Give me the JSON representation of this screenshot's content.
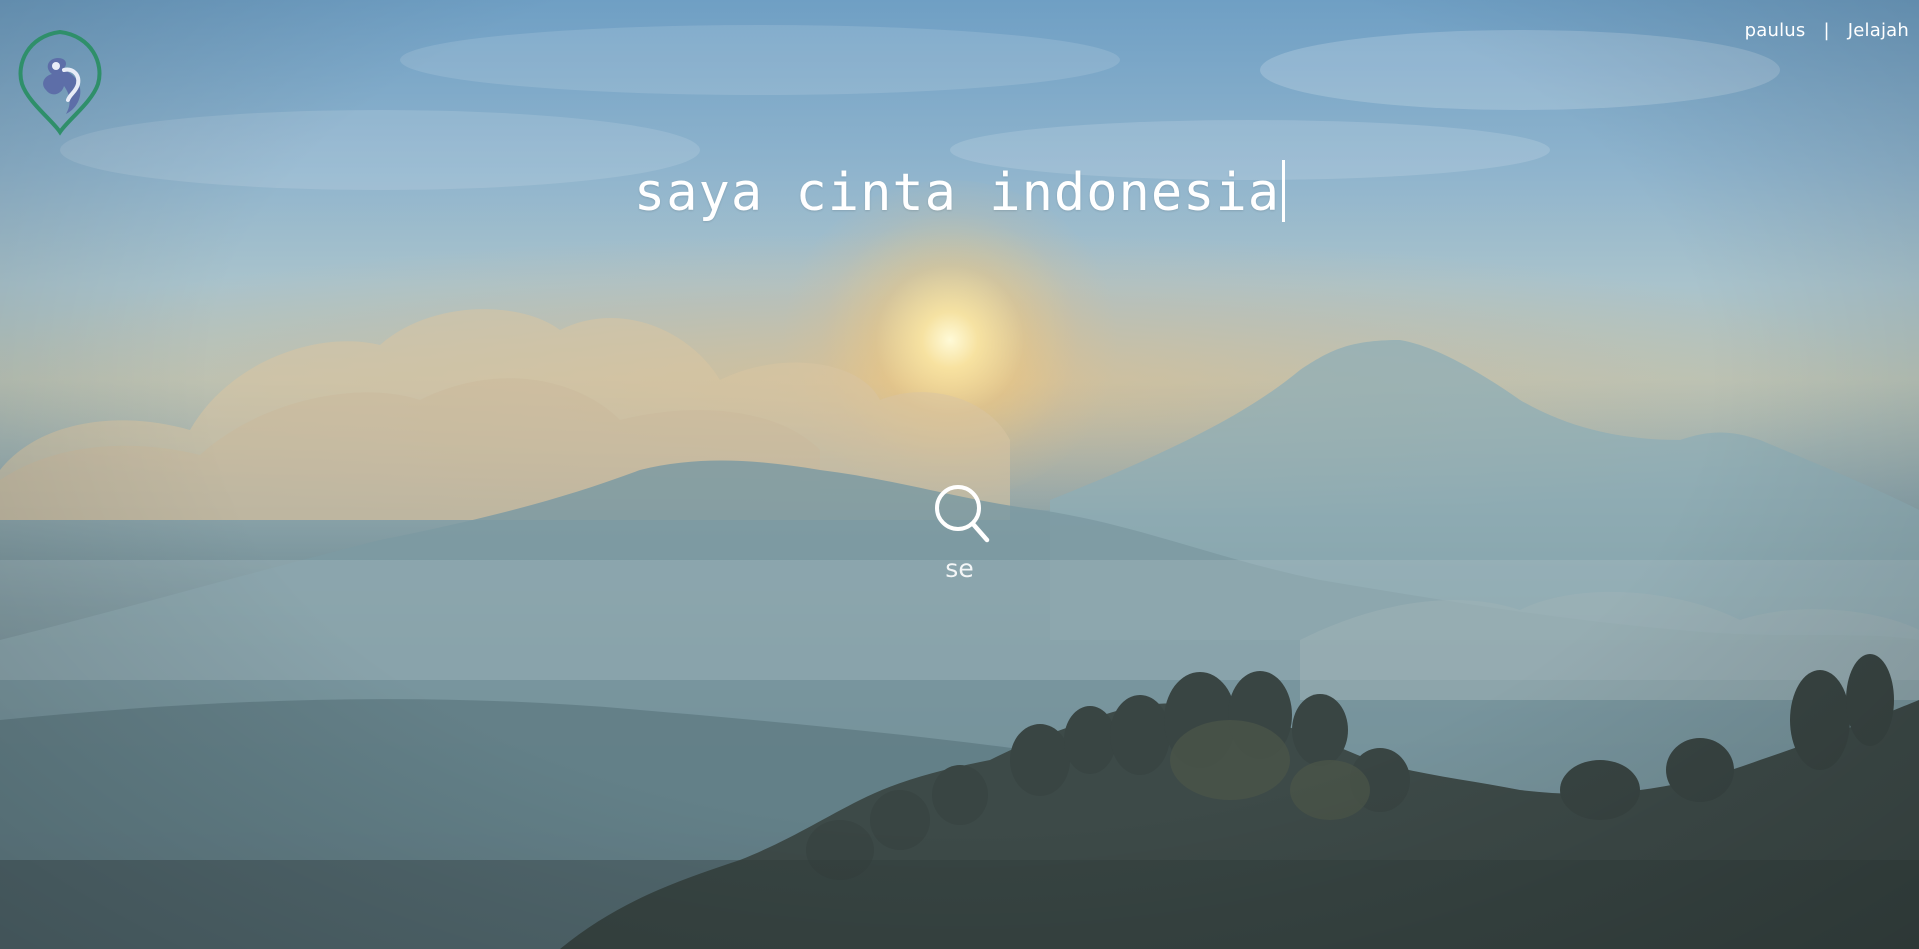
{
  "nav": {
    "user": "paulus",
    "separator": "|",
    "explore": "Jelajah"
  },
  "hero": {
    "headline": "saya cinta indonesia"
  },
  "search": {
    "value": "se"
  },
  "icons": {
    "logo": "flower-drop-logo-icon",
    "search": "search-icon"
  }
}
